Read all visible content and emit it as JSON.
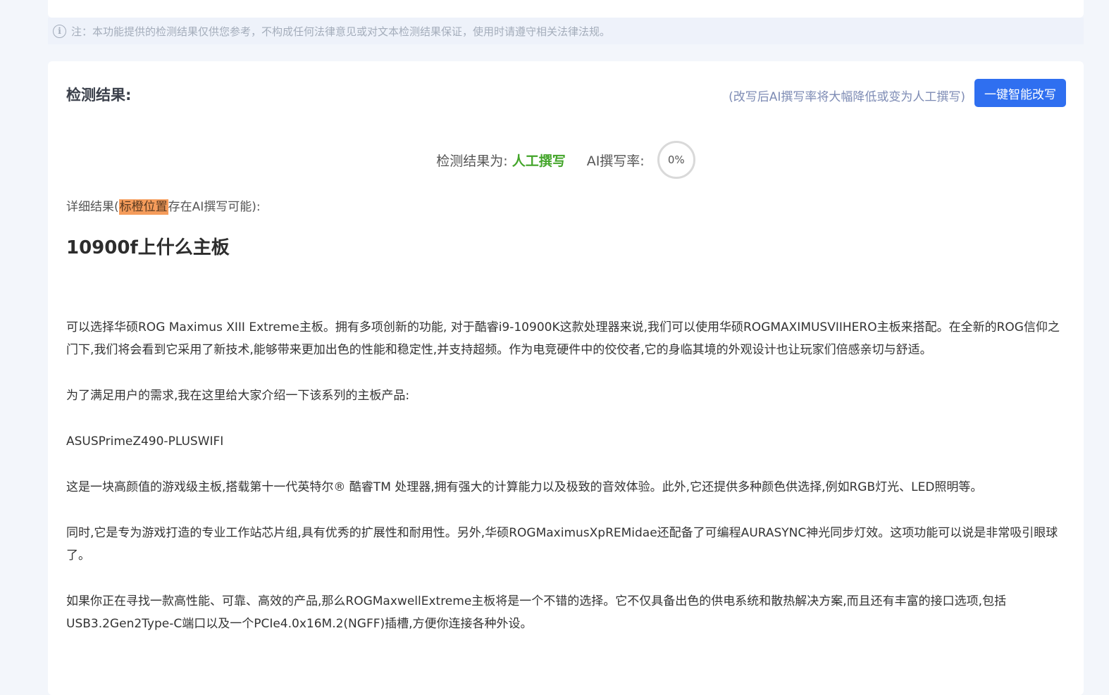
{
  "notice": {
    "icon": "info-icon",
    "text": "注：本功能提供的检测结果仅供您参考，不构成任何法律意见或对文本检测结果保证，使用时请遵守相关法律法规。"
  },
  "result": {
    "title": "检测结果:",
    "rewrite_hint": "(改写后AI撰写率将大幅降低或变为人工撰写)",
    "rewrite_button": "一键智能改写",
    "summary_label": "检测结果为:",
    "verdict": "人工撰写",
    "ai_rate_label": "AI撰写率:",
    "ai_rate": "0%",
    "detail_prefix": "详细结果(",
    "detail_highlight": "标橙位置",
    "detail_suffix": "存在AI撰写可能):"
  },
  "article": {
    "title": "10900f上什么主板",
    "paragraphs": [
      "可以选择华硕ROG Maximus XIII Extreme主板。拥有多项创新的功能, 对于酷睿i9-10900K这款处理器来说,我们可以使用华硕ROGMAXIMUSVIIHERO主板来搭配。在全新的ROG信仰之门下,我们将会看到它采用了新技术,能够带来更加出色的性能和稳定性,并支持超频。作为电竞硬件中的佼佼者,它的身临其境的外观设计也让玩家们倍感亲切与舒适。",
      "为了满足用户的需求,我在这里给大家介绍一下该系列的主板产品:",
      "ASUSPrimeZ490-PLUSWIFI",
      "这是一块高颜值的游戏级主板,搭载第十一代英特尔® 酷睿TM 处理器,拥有强大的计算能力以及极致的音效体验。此外,它还提供多种颜色供选择,例如RGB灯光、LED照明等。",
      "同时,它是专为游戏打造的专业工作站芯片组,具有优秀的扩展性和耐用性。另外,华硕ROGMaximusXpREMidae还配备了可编程AURASYNC神光同步灯效。这项功能可以说是非常吸引眼球了。",
      "如果你正在寻找一款高性能、可靠、高效的产品,那么ROGMaxwellExtreme主板将是一个不错的选择。它不仅具备出色的供电系统和散热解决方案,而且还有丰富的接口选项,包括USB3.2Gen2Type-C端口以及一个PCIe4.0x16M.2(NGFF)插槽,方便你连接各种外设。"
    ]
  },
  "colors": {
    "accent": "#2f6ff0",
    "verdict": "#43a52a",
    "highlight": "#f59c5b"
  }
}
